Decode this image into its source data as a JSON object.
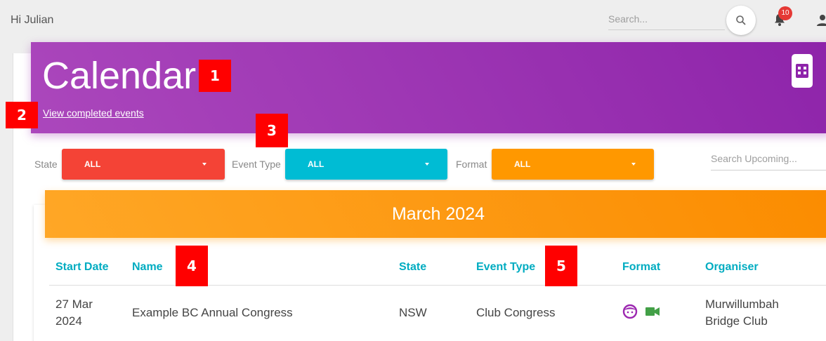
{
  "topbar": {
    "greeting": "Hi Julian",
    "search_placeholder": "Search...",
    "notification_count": "10"
  },
  "calendar": {
    "title": "Calendar",
    "view_completed_link": "View completed events",
    "accent_color": "#9c27b0"
  },
  "filters": {
    "state": {
      "label": "State",
      "value": "ALL",
      "color": "#f44336"
    },
    "event_type": {
      "label": "Event Type",
      "value": "ALL",
      "color": "#00bcd4"
    },
    "format": {
      "label": "Format",
      "value": "ALL",
      "color": "#ff9800"
    },
    "search_placeholder": "Search Upcoming..."
  },
  "month": {
    "label": "March 2024"
  },
  "table": {
    "headers": [
      "Start Date",
      "Name",
      "State",
      "Event Type",
      "Format",
      "Organiser"
    ],
    "rows": [
      {
        "start_date": "27 Mar 2024",
        "start_date_line1": "27 Mar",
        "start_date_line2": "2024",
        "name": "Example BC Annual Congress",
        "state": "NSW",
        "event_type": "Club Congress",
        "format_icons": [
          "face-icon",
          "video-camera-icon"
        ],
        "organiser_line1": "Murwillumbah",
        "organiser_line2": "Bridge Club"
      }
    ]
  },
  "markers": [
    "1",
    "2",
    "3",
    "4",
    "5"
  ]
}
